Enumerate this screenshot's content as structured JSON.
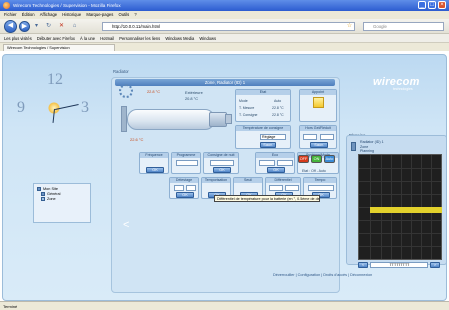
{
  "browser": {
    "title": "Wirecom Technologies / Supervision - Mozilla Firefox",
    "menu": [
      "Fichier",
      "Édition",
      "Affichage",
      "Historique",
      "Marque-pages",
      "Outils",
      "?"
    ],
    "url": "http://10.0.0.11/main.html",
    "search_placeholder": "Google",
    "bookmarks": [
      "Les plus visités",
      "Débuter avec Firefox",
      "À la une",
      "Hotmail",
      "Personnaliser les liens",
      "Windows Media",
      "Windows"
    ],
    "tab_label": "Wirecom Technologies / Supervision",
    "status": "Terminé"
  },
  "app": {
    "logo": "wirecom",
    "logo_sub": "technologies",
    "tree": [
      {
        "label": "Mon Site"
      },
      {
        "label": "Général"
      },
      {
        "label": "Zone"
      }
    ],
    "zone_header": "Zone, Radiator (ID) 1",
    "section_label": "Radiator",
    "temp_inside": "22.8 °C",
    "ext_label": "Extérieure",
    "ext_temp": "20.8 °C",
    "temp_tank": "22.6 °C",
    "boxes": {
      "etat": {
        "title": "État",
        "lines": [
          "Mode",
          "T. Mesure",
          "T. Consigne"
        ],
        "values": [
          "Auto",
          "22.8 °C",
          "22.8 °C"
        ]
      },
      "appoint": {
        "title": "Appoint"
      },
      "consigne": {
        "title": "Température de consigne",
        "field": "Réglage",
        "btn": "Sauv."
      },
      "hors_gel": {
        "title": "Hors Gel/Réduit",
        "btn": "Sauv."
      },
      "frequence": {
        "title": "Fréquence",
        "btn": "OK"
      },
      "programme": {
        "title": "Programme",
        "btn": "OK"
      },
      "consigne_nuit": {
        "title": "Consigne de nuit",
        "btn": "OK"
      },
      "eco": {
        "title": "Eco",
        "btn": "OK"
      },
      "systeme": {
        "title": "Système/Mode",
        "buttons": [
          "OFF",
          "ON",
          "Auto"
        ],
        "line": "Etat : Off - Auto"
      },
      "delestage": {
        "title": "Délestage",
        "btn": "OK"
      },
      "temporisation": {
        "title": "Temporisation",
        "btn": "OK"
      },
      "seuil": {
        "title": "Seuil",
        "btn": "OK"
      },
      "differentiel": {
        "title": "Différentiel",
        "btn": "OK"
      },
      "tempo2": {
        "title": "Tempo",
        "btn": "OK"
      }
    },
    "tooltip": "Différentiel de température pour la batterie (en °, 0.5ème de degrés)",
    "planning": {
      "title": "Planning",
      "lines": [
        "Radiator (ID) 1",
        "Zone",
        "Planning"
      ],
      "footer_value": "TTTTTTTTT"
    },
    "footer_links": "Déverrouiller | Configuration | Droits d'accès | Déconnexion",
    "colors": {
      "accent": "#4f84c8",
      "band": "#e2d12c",
      "off": "#d63a1c",
      "on": "#46b43a",
      "auto": "#3b8bd6"
    }
  }
}
